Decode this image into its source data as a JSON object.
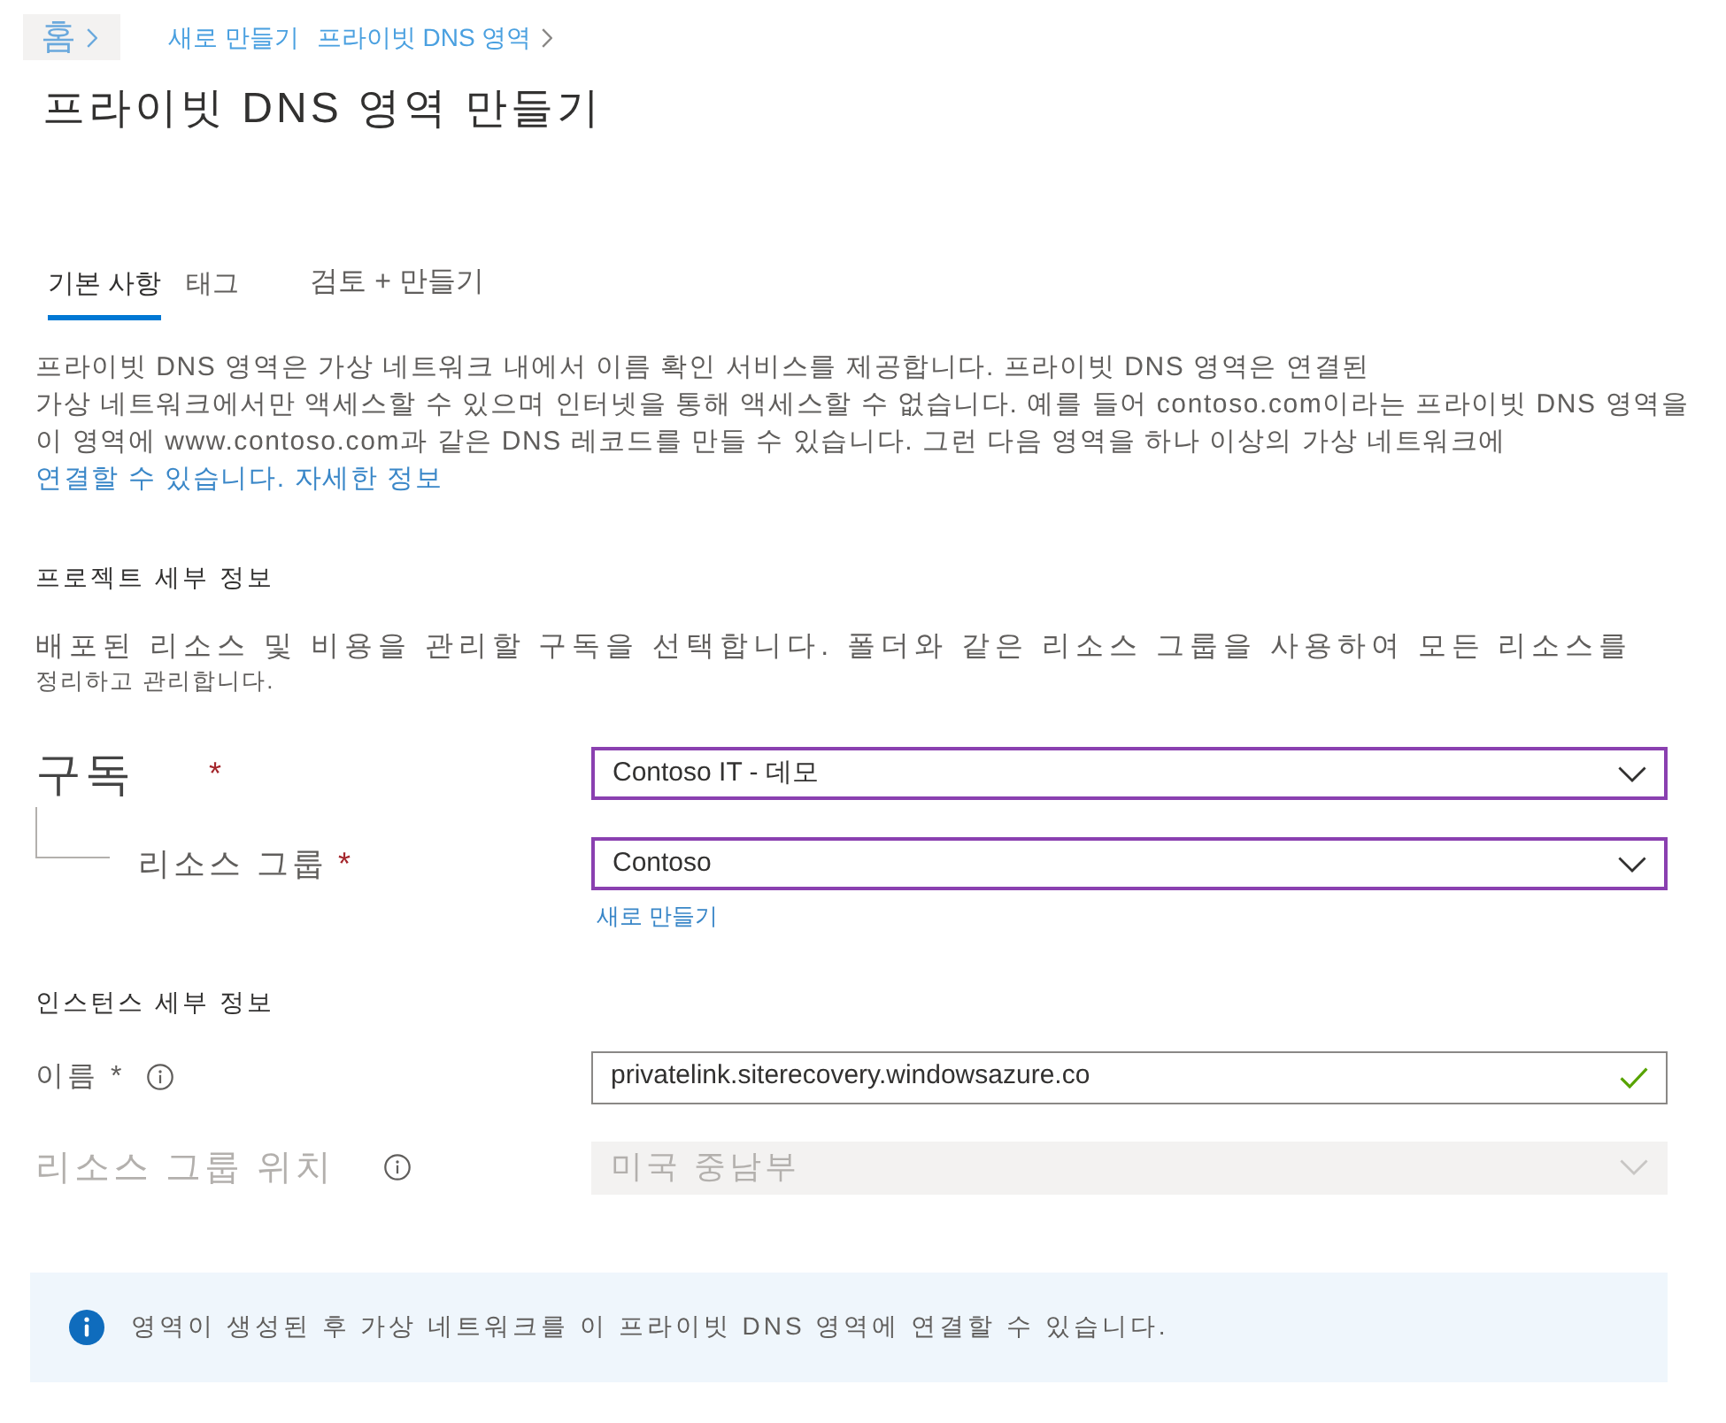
{
  "breadcrumb": [
    {
      "label": "홈",
      "kind": "home"
    },
    {
      "label": "새로 만들기",
      "kind": "link"
    },
    {
      "label": "프라이빗 DNS 영역",
      "kind": "link"
    }
  ],
  "title": "프라이빗 DNS 영역 만들기",
  "tabs": [
    {
      "label": "기본 사항",
      "selected": true
    },
    {
      "label": "태그",
      "selected": false
    },
    {
      "label": "검토 + 만들기",
      "selected": false
    }
  ],
  "intro": {
    "lines": [
      "프라이빗 DNS 영역은 가상 네트워크 내에서 이름 확인 서비스를 제공합니다. 프라이빗 DNS 영역은 연결된",
      "가상 네트워크에서만 액세스할 수 있으며 인터넷을 통해 액세스할 수 없습니다. 예를 들어 contoso.com이라는 프라이빗 DNS 영역을",
      "이 영역에 www.contoso.com과 같은 DNS 레코드를 만들 수 있습니다. 그런 다음 영역을 하나 이상의 가상 네트워크에"
    ],
    "link": "연결할 수 있습니다. 자세한 정보"
  },
  "project": {
    "heading": "프로젝트 세부 정보",
    "lines": [
      "배포된 리소스 및 비용을 관리할 구독을 선택합니다. 폴더와 같은 리소스 그룹을 사용하여 모든 리소스를",
      "정리하고 관리합니다."
    ],
    "fields": [
      {
        "label": "구독",
        "required_mark": "*",
        "kind": "dropdown",
        "value": "Contoso IT - 데모",
        "disabled": false,
        "children": [
          {
            "label": "리소스 그룹",
            "required_mark": "*",
            "kind": "dropdown",
            "value": "Contoso",
            "disabled": false,
            "link": "새로 만들기"
          }
        ]
      }
    ]
  },
  "instance": {
    "heading": "인스턴스 세부 정보",
    "fields": [
      {
        "label": "이름 *",
        "info": true,
        "kind": "text",
        "value": "privatelink.siterecovery.windowsazure.co",
        "valid": true,
        "disabled": false
      },
      {
        "label": "리소스 그룹 위치",
        "info": true,
        "kind": "dropdown",
        "value": "미국 중남부",
        "disabled": true
      }
    ]
  },
  "notice": {
    "text": "영역이 생성된 후 가상 네트워크를 이 프라이빗 DNS 영역에 연결할 수 있습니다."
  }
}
